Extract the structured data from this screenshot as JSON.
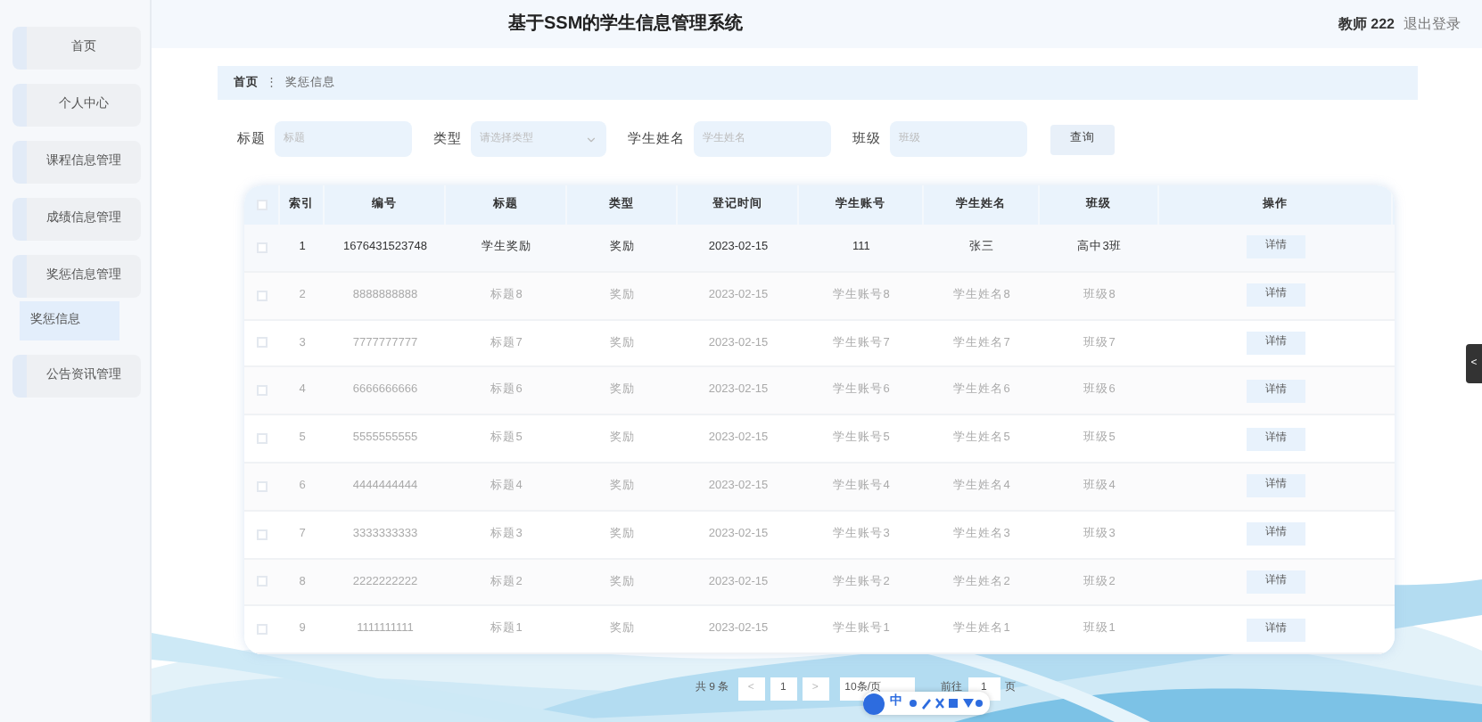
{
  "header": {
    "title": "基于SSM的学生信息管理系统",
    "user": "教师 222",
    "logout": "退出登录"
  },
  "sidebar": {
    "items": [
      {
        "label": "首页"
      },
      {
        "label": "个人中心"
      },
      {
        "label": "课程信息管理"
      },
      {
        "label": "成绩信息管理"
      },
      {
        "label": "奖惩信息管理",
        "children": [
          {
            "label": "奖惩信息",
            "selected": true
          }
        ]
      },
      {
        "label": "公告资讯管理"
      }
    ]
  },
  "breadcrumb": {
    "items": [
      "首页",
      "奖惩信息"
    ],
    "separator": "⋮"
  },
  "search": {
    "fields": [
      {
        "label": "标题",
        "kind": "input",
        "placeholder": "标题"
      },
      {
        "label": "类型",
        "kind": "select",
        "placeholder": "请选择类型"
      },
      {
        "label": "学生姓名",
        "kind": "input",
        "placeholder": "学生姓名"
      },
      {
        "label": "班级",
        "kind": "input",
        "placeholder": "班级"
      }
    ],
    "button": "查询"
  },
  "table": {
    "all_checked": false,
    "columns": [
      "索引",
      "编号",
      "标题",
      "类型",
      "登记时间",
      "学生账号",
      "学生姓名",
      "班级",
      "操作"
    ],
    "rows": [
      {
        "cells": [
          "1",
          "1676431523748",
          "学生奖励",
          "奖励",
          "2023-02-15",
          "111",
          "张三",
          "高中3班"
        ],
        "action": "详情",
        "highlighted": true
      },
      {
        "cells": [
          "2",
          "8888888888",
          "标题8",
          "奖励",
          "2023-02-15",
          "学生账号8",
          "学生姓名8",
          "班级8"
        ],
        "action": "详情",
        "highlighted": false
      },
      {
        "cells": [
          "3",
          "7777777777",
          "标题7",
          "奖励",
          "2023-02-15",
          "学生账号7",
          "学生姓名7",
          "班级7"
        ],
        "action": "详情",
        "highlighted": false
      },
      {
        "cells": [
          "4",
          "6666666666",
          "标题6",
          "奖励",
          "2023-02-15",
          "学生账号6",
          "学生姓名6",
          "班级6"
        ],
        "action": "详情",
        "highlighted": false
      },
      {
        "cells": [
          "5",
          "5555555555",
          "标题5",
          "奖励",
          "2023-02-15",
          "学生账号5",
          "学生姓名5",
          "班级5"
        ],
        "action": "详情",
        "highlighted": false
      },
      {
        "cells": [
          "6",
          "4444444444",
          "标题4",
          "奖励",
          "2023-02-15",
          "学生账号4",
          "学生姓名4",
          "班级4"
        ],
        "action": "详情",
        "highlighted": false
      },
      {
        "cells": [
          "7",
          "3333333333",
          "标题3",
          "奖励",
          "2023-02-15",
          "学生账号3",
          "学生姓名3",
          "班级3"
        ],
        "action": "详情",
        "highlighted": false
      },
      {
        "cells": [
          "8",
          "2222222222",
          "标题2",
          "奖励",
          "2023-02-15",
          "学生账号2",
          "学生姓名2",
          "班级2"
        ],
        "action": "详情",
        "highlighted": false
      },
      {
        "cells": [
          "9",
          "1111111111",
          "标题1",
          "奖励",
          "2023-02-15",
          "学生账号1",
          "学生姓名1",
          "班级1"
        ],
        "action": "详情",
        "highlighted": false
      }
    ]
  },
  "pagination": {
    "total": "共 9 条",
    "prev": "<",
    "page": "1",
    "next": ">",
    "page_size": "10条/页",
    "goto": "前往",
    "goto_value": "1",
    "goto_unit": "页"
  },
  "ime_toolbar": {
    "mode": "中"
  },
  "side_handle": "<"
}
